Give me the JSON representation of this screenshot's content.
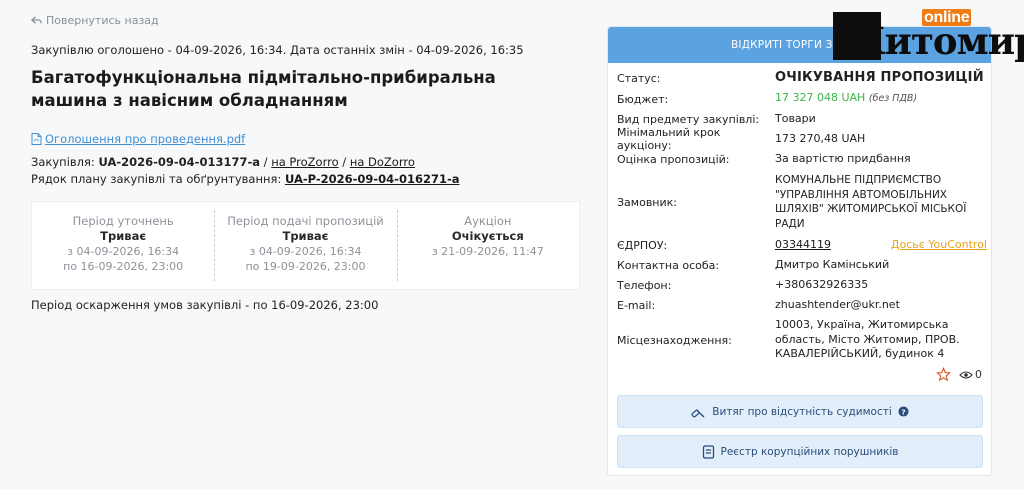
{
  "back": {
    "label": "Повернутись назад"
  },
  "announced": "Закупівлю оголошено - 04-09-2026, 16:34. Дата останніх змін - 04-09-2026, 16:35",
  "title": "Багатофункціональна підмітально-прибиральна машина з навісним обладнанням",
  "pdf": {
    "label": "Оголошення про проведення.pdf"
  },
  "procurement": {
    "label": "Закупівля:",
    "id": "UA-2026-09-04-013177-a",
    "sep1": "/",
    "prozorro": "на ProZorro",
    "sep2": "/",
    "dozorro": "на DoZorro"
  },
  "plan": {
    "label": "Рядок плану закупівлі та обґрунтування:",
    "id": "UA-P-2026-09-04-016271-a"
  },
  "periods": [
    {
      "head": "Період уточнень",
      "status": "Триває",
      "from": "з 04-09-2026, 16:34",
      "to": "по 16-09-2026, 23:00"
    },
    {
      "head": "Період подачі пропозицій",
      "status": "Триває",
      "from": "з 04-09-2026, 16:34",
      "to": "по 19-09-2026, 23:00"
    },
    {
      "head": "Аукціон",
      "status": "Очікується",
      "from": "з 21-09-2026, 11:47",
      "to": ""
    }
  ],
  "appeal": "Період оскарження умов закупівлі - по 16-09-2026, 23:00",
  "card": {
    "header": "ВІДКРИТІ ТОРГИ З ОСОБ",
    "status_label": "Статус:",
    "status_value": "ОЧІКУВАННЯ ПРОПОЗИЦІЙ",
    "budget_label": "Бюджет:",
    "budget_value": "17 327 048 UAH",
    "budget_note": "(без ПДВ)",
    "subject_label": "Вид предмету закупівлі:",
    "subject_value": "Товари",
    "step_label": "Мінімальний крок аукціону:",
    "step_value": "173 270,48 UAH",
    "eval_label": "Оцінка пропозицій:",
    "eval_value": "За вартістю придбання",
    "customer_label": "Замовник:",
    "customer_value": "КОМУНАЛЬНЕ ПІДПРИЄМСТВО \"УПРАВЛІННЯ АВТОМОБІЛЬНИХ ШЛЯХІВ\" ЖИТОМИРСЬКОЇ МІСЬКОЇ РАДИ",
    "edrpou_label": "ЄДРПОУ:",
    "edrpou_value": "03344119",
    "youcontrol": "Досьє YouControl",
    "contact_label": "Контактна особа:",
    "contact_value": "Дмитро Камінський",
    "phone_label": "Телефон:",
    "phone_value": "+380632926335",
    "email_label": "E-mail:",
    "email_value": "zhuashtender@ukr.net",
    "location_label": "Місцезнаходження:",
    "location_value": "10003, Україна, Житомирська область, Місто Житомир, ПРОВ. КАВАЛЕРІЙСЬКИЙ, будинок 4",
    "views": "0",
    "btn_criminal": "Витяг про відсутність судимості",
    "btn_corruption": "Реєстр корупційних порушників"
  },
  "logo": {
    "online": "online",
    "word": "Житомир",
    "icons": [
      "star-icon",
      "eye-icon",
      "help-icon",
      "document-icon",
      "pdf-icon",
      "back-arrow-icon"
    ]
  },
  "colors": {
    "accent": "#5aa2e0",
    "budget": "#3ab54a",
    "youcontrol": "#e6a31a",
    "logo_orange": "#f07c16"
  }
}
